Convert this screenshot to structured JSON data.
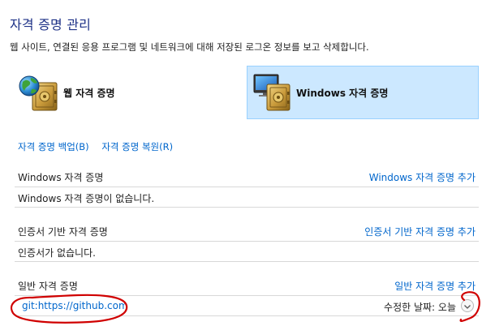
{
  "header": {
    "title": "자격 증명 관리",
    "description": "웹 사이트, 연결된 응용 프로그램 및 네트워크에 대해 저장된 로그온 정보를 보고 삭제합니다."
  },
  "vaults": [
    {
      "label": "웹 자격 증명",
      "icon": "web-vault-icon",
      "selected": false
    },
    {
      "label": "Windows 자격 증명",
      "icon": "windows-vault-icon",
      "selected": true
    }
  ],
  "actions": {
    "backup": "자격 증명 백업(B)",
    "restore": "자격 증명 복원(R)"
  },
  "sections": {
    "windows": {
      "title": "Windows 자격 증명",
      "add_link": "Windows 자격 증명 추가",
      "empty_text": "Windows 자격 증명이 없습니다."
    },
    "certificate": {
      "title": "인증서 기반 자격 증명",
      "add_link": "인증서 기반 자격 증명 추가",
      "empty_text": "인증서가 없습니다."
    },
    "generic": {
      "title": "일반 자격 증명",
      "add_link": "일반 자격 증명 추가",
      "items": [
        {
          "name": "git:https://github.com",
          "modified": "수정한 날짜:  오늘"
        }
      ]
    }
  },
  "colors": {
    "title": "#1e3287",
    "link": "#0066cc",
    "selected_tile": "#cce8ff",
    "selected_border": "#99d1ff",
    "annotation": "#d00000"
  }
}
